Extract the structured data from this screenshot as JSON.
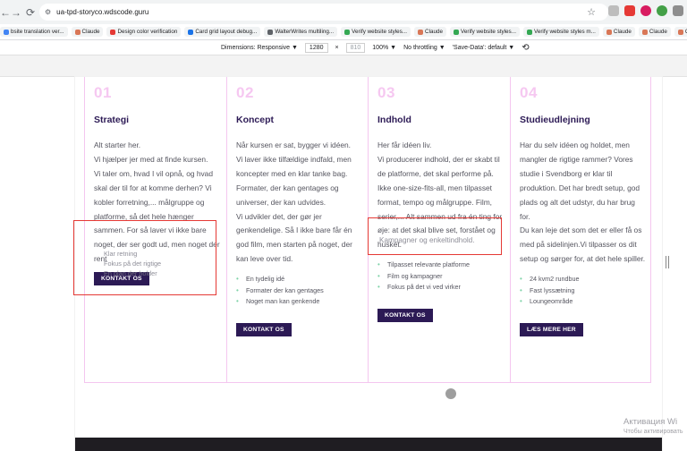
{
  "browser": {
    "url": "ua-tpd-storyco.wdscode.guru",
    "nav": {
      "back": "←",
      "forward": "→",
      "reload": "⟳"
    },
    "bookmarks": [
      {
        "label": "bsite translation ver...",
        "color": "#4285f4"
      },
      {
        "label": "Claude",
        "color": "#d97757"
      },
      {
        "label": "Design color verification",
        "color": "#e53935"
      },
      {
        "label": "Card grid layout debug...",
        "color": "#1a73e8"
      },
      {
        "label": "WalterWrites multiling...",
        "color": "#5f6368"
      },
      {
        "label": "Verify website styles...",
        "color": "#34a853"
      },
      {
        "label": "Claude",
        "color": "#d97757"
      },
      {
        "label": "Verify website styles...",
        "color": "#34a853"
      },
      {
        "label": "Verify website styles m...",
        "color": "#34a853"
      },
      {
        "label": "Claude",
        "color": "#d97757"
      },
      {
        "label": "Claude",
        "color": "#d97757"
      },
      {
        "label": "Claude",
        "color": "#d97757"
      },
      {
        "label": "Claude",
        "color": "#d97757"
      }
    ]
  },
  "devtools": {
    "dimensions_label": "Dimensions: Responsive ▼",
    "width": "1280",
    "times": "×",
    "height": "810",
    "zoom": "100% ▼",
    "throttle": "No throttling ▼",
    "save_data": "'Save-Data': default ▼",
    "rotate_icon": "⟲"
  },
  "columns": [
    {
      "num": "01",
      "title": "Strategi",
      "body": "Alt starter her.\nVi hjælper jer med at finde kursen.\nVi taler om, hvad I vil opnå,  og hvad skal der til for at komme derhen? Vi kobler forretning,... målgruppe og platforme, så det hele hænger sammen. For så laver vi ikke bare noget, der ser godt ud,  men noget der rent",
      "bullets": [],
      "button": "KONTAKT OS"
    },
    {
      "num": "02",
      "title": "Koncept",
      "body": "Når kursen er sat, bygger vi idéen.\nVi laver ikke tilfældige indfald, men koncepter med en klar tanke bag. Formater, der kan gentages og universer, der kan udvides.\nVi udvikler det, der gør jer genkendelige. Så I ikke bare får én god film, men starten på noget, der kan leve over tid.",
      "bullets": [
        "En tydelig idé",
        "Formater der kan gentages",
        "Noget man kan genkende"
      ],
      "button": "KONTAKT OS"
    },
    {
      "num": "03",
      "title": "Indhold",
      "body": "Her får idéen liv.\nVi producerer indhold, der er skabt til de platforme, det skal performe på. Ikke one-size-fits-all, men tilpasset format, tempo og målgruppe. Film, serier,... Alt sammen ud fra én ting for øje: at det skal blive set, forstået og husket.",
      "bullets": [
        "Tilpasset relevante platforme",
        "Film og kampagner",
        "Fokus på det vi ved virker"
      ],
      "button": "KONTAKT OS"
    },
    {
      "num": "04",
      "title": "Studieudlejning",
      "body": "Har du selv idéen og holdet, men mangler de rigtige rammer? Vores studie i Svendborg er klar til produktion. Det har bredt setup, god plads og alt det udstyr, du har brug for.\nDu kan leje det som det er eller få os med på sidelinjen.Vi tilpasser os dit setup og sørger for, at det hele spiller.",
      "bullets": [
        "24 kvm2 rundbue",
        "Fast lyssætning",
        "Loungeområde"
      ],
      "button": "LÆS MERE HER"
    }
  ],
  "overlap_col1": [
    "Klar retning",
    "Fokus på det rigtige",
    "En plan der holder"
  ],
  "overlap_col3": "Kampagner og enkeltindhold.",
  "watermark": {
    "line1": "Активация Wi",
    "line2": "Чтобы активировать"
  }
}
